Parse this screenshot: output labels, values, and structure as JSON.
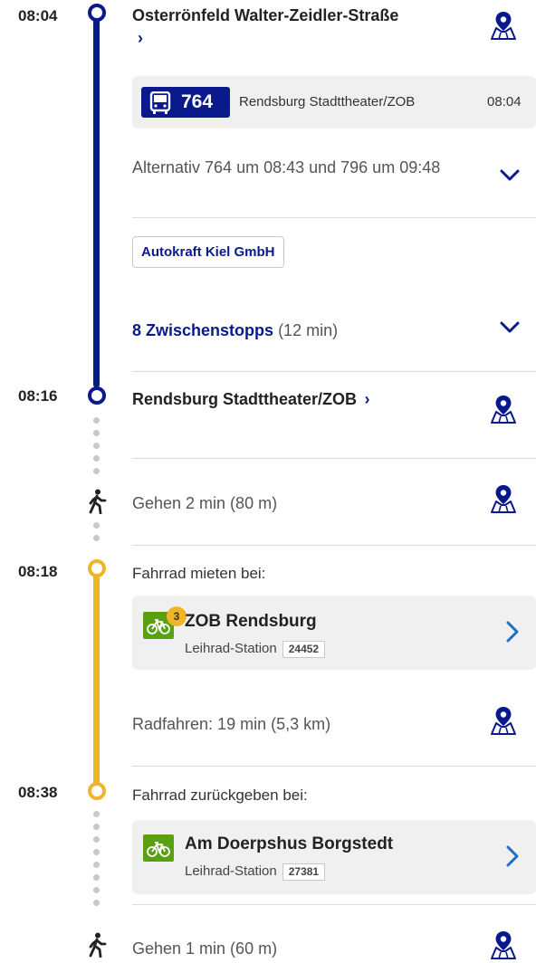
{
  "colors": {
    "bus_line": "#0a1a8c",
    "bike_line": "#f0b429",
    "bike_badge": "#5aa013",
    "walk_dots": "#c8c8c8"
  },
  "departure": {
    "time": "08:04",
    "stop": "Osterrönfeld Walter-Zeidler-Straße",
    "chevron": "›",
    "icon": "map-pin-icon"
  },
  "bus": {
    "icon": "bus-icon",
    "line": "764",
    "destination": "Rendsburg Stadttheater/ZOB",
    "departure_time": "08:04",
    "alternatives": "Alternativ 764 um 08:43 und 796 um 09:48",
    "operator": "Autokraft Kiel GmbH",
    "stops_label": "8 Zwischenstopps",
    "stops_duration": "(12 min)"
  },
  "arrival_bus": {
    "time": "08:16",
    "stop": "Rendsburg Stadttheater/ZOB",
    "chevron": "›"
  },
  "walk1": {
    "icon": "walking-person-icon",
    "text": "Gehen 2 min (80 m)"
  },
  "rent": {
    "time": "08:18",
    "label": "Fahrrad mieten bei:",
    "station_name": "ZOB Rendsburg",
    "station_type": "Leihrad-Station",
    "station_id": "24452",
    "available": "3"
  },
  "ride": {
    "text": "Radfahren: 19 min (5,3 km)"
  },
  "return": {
    "time": "08:38",
    "label": "Fahrrad zurückgeben bei:",
    "station_name": "Am Doerpshus Borgstedt",
    "station_type": "Leihrad-Station",
    "station_id": "27381"
  },
  "walk2": {
    "icon": "walking-person-icon",
    "text": "Gehen 1 min (60 m)"
  }
}
